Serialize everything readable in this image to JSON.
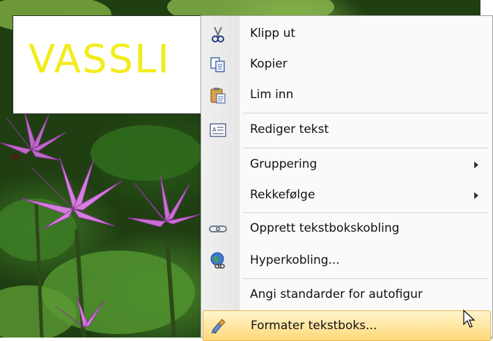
{
  "slide": {
    "textbox_text": "VASSLI"
  },
  "menu": {
    "items": [
      {
        "label": "Klipp ut",
        "icon": "scissors-icon"
      },
      {
        "label": "Kopier",
        "icon": "copy-icon"
      },
      {
        "label": "Lim inn",
        "icon": "paste-icon"
      },
      {
        "label": "Rediger tekst",
        "icon": "edit-text-icon"
      },
      {
        "label": "Gruppering",
        "submenu": true
      },
      {
        "label": "Rekkefølge",
        "submenu": true
      },
      {
        "label": "Opprett tekstbokskobling",
        "icon": "chain-link-icon"
      },
      {
        "label": "Hyperkobling...",
        "icon": "hyperlink-globe-icon"
      },
      {
        "label": "Angi standarder for autofigur"
      },
      {
        "label": "Formater tekstboks...",
        "icon": "format-brush-icon",
        "highlighted": true
      }
    ]
  },
  "colors": {
    "textbox_text": "#f2ec1c",
    "highlight_top": "#fff4cc",
    "highlight_bottom": "#ffd97a",
    "highlight_border": "#e3b44b"
  }
}
